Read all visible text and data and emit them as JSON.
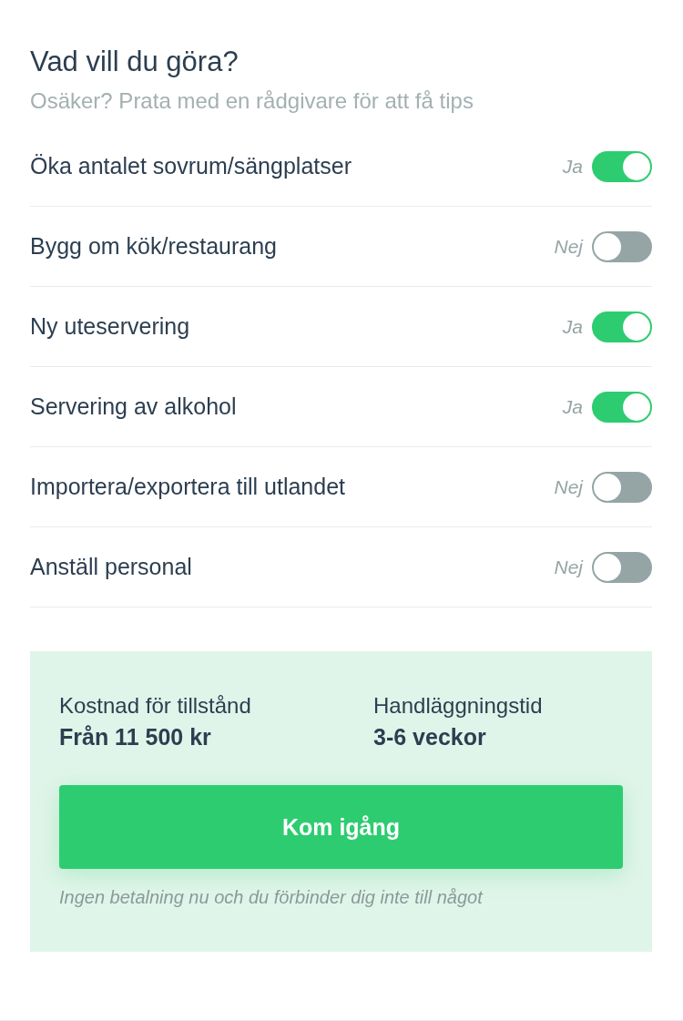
{
  "heading": {
    "title": "Vad vill du göra?",
    "subtitle": "Osäker? Prata med en rådgivare för att få tips"
  },
  "options": [
    {
      "label": "Öka antalet sovrum/sängplatser",
      "state_text": "Ja",
      "on": true
    },
    {
      "label": "Bygg om kök/restaurang",
      "state_text": "Nej",
      "on": false
    },
    {
      "label": "Ny uteservering",
      "state_text": "Ja",
      "on": true
    },
    {
      "label": "Servering av alkohol",
      "state_text": "Ja",
      "on": true
    },
    {
      "label": "Importera/exportera till utlandet",
      "state_text": "Nej",
      "on": false
    },
    {
      "label": "Anställ personal",
      "state_text": "Nej",
      "on": false
    }
  ],
  "summary": {
    "facts": [
      {
        "label": "Kostnad för tillstånd",
        "value": "Från 11 500 kr"
      },
      {
        "label": "Handläggningstid",
        "value": "3-6 veckor"
      }
    ],
    "button": "Kom igång",
    "note": "Ingen betalning nu och du förbinder dig inte till något"
  }
}
